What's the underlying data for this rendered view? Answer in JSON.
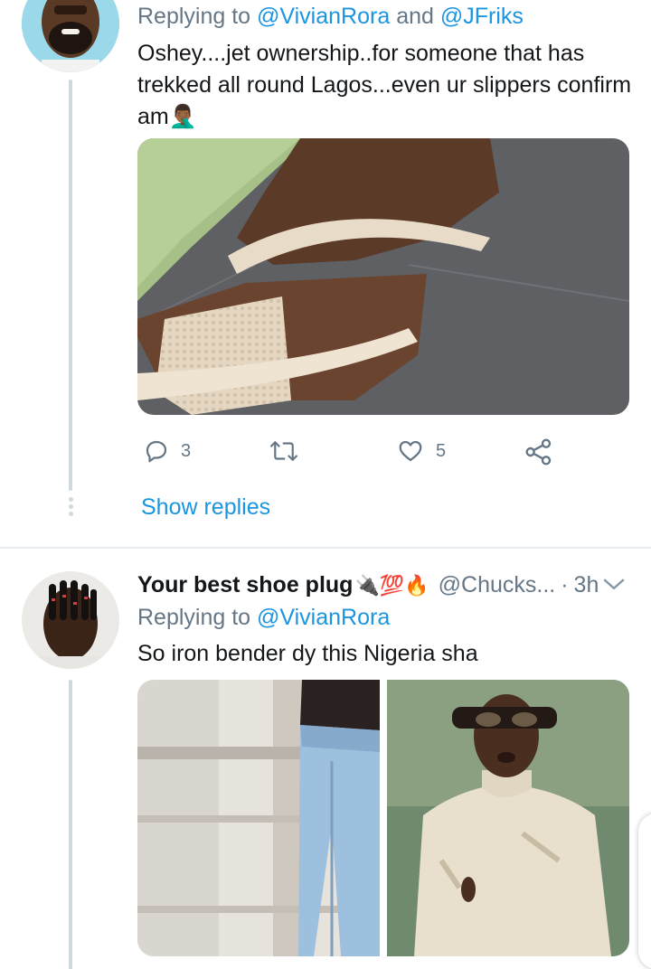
{
  "tweet1": {
    "replying_prefix": "Replying to ",
    "mention1": "@VivianRora",
    "and": " and ",
    "mention2": "@JFriks",
    "text_line1": "Oshey....jet ownership..for someone that has",
    "text_line2": "trekked all round Lagos...even ur slippers confirm",
    "text_line3": "am🤦🏾‍♂️",
    "reply_count": "3",
    "like_count": "5",
    "show_replies": "Show replies"
  },
  "tweet2": {
    "display_name": "Your best shoe plug",
    "name_emojis": "🔌💯🔥",
    "handle": "@Chucks...",
    "separator": "·",
    "time": "3h",
    "replying_prefix": "Replying to ",
    "mention1": "@VivianRora",
    "text": "So iron bender dy this Nigeria sha"
  },
  "icons": {
    "reply": "reply-icon",
    "retweet": "retweet-icon",
    "like": "heart-icon",
    "share": "share-icon",
    "more": "chevron-down-icon"
  },
  "colors": {
    "link": "#1b95e0",
    "muted": "#657786",
    "thread_line": "#cfd9de",
    "divider": "#e6ecf0"
  }
}
